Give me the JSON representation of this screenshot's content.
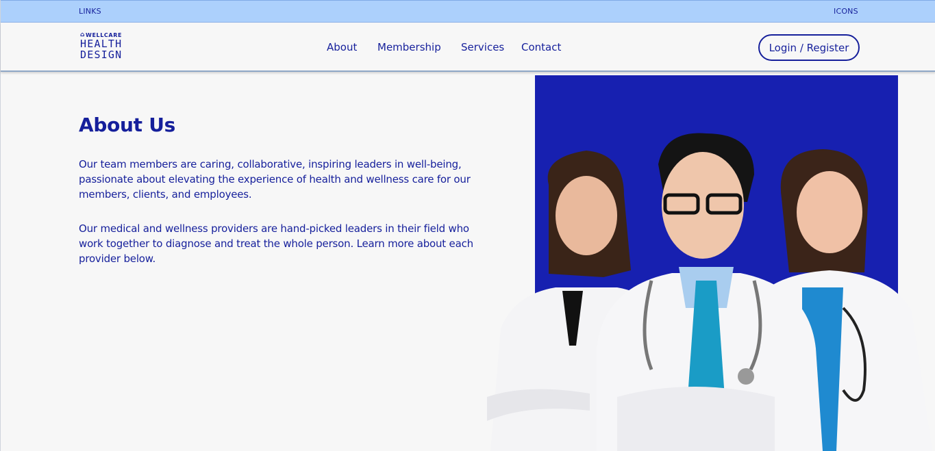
{
  "topbar": {
    "links_label": "LINKS",
    "icons_label": "ICONS"
  },
  "header": {
    "logo": {
      "line1": "WELLCARE",
      "line2": "HEALTH",
      "line3": "DESIGN"
    },
    "nav": [
      "About",
      "Membership",
      "Services",
      "Contact"
    ],
    "login_label": "Login / Register"
  },
  "content": {
    "title": "About Us",
    "paragraphs": [
      "Our team members are caring, collaborative, inspiring leaders in well-being, passionate about elevating the experience of health and wellness care for our members, clients, and employees.",
      "Our medical and wellness providers are hand-picked leaders in their field who work together to diagnose and treat the whole person. Learn more about each provider below."
    ]
  },
  "colors": {
    "brand": "#151f9b",
    "topbar_bg": "#acd0fc",
    "hero_bg": "#1720b0",
    "page_bg": "#f7f7f7"
  }
}
